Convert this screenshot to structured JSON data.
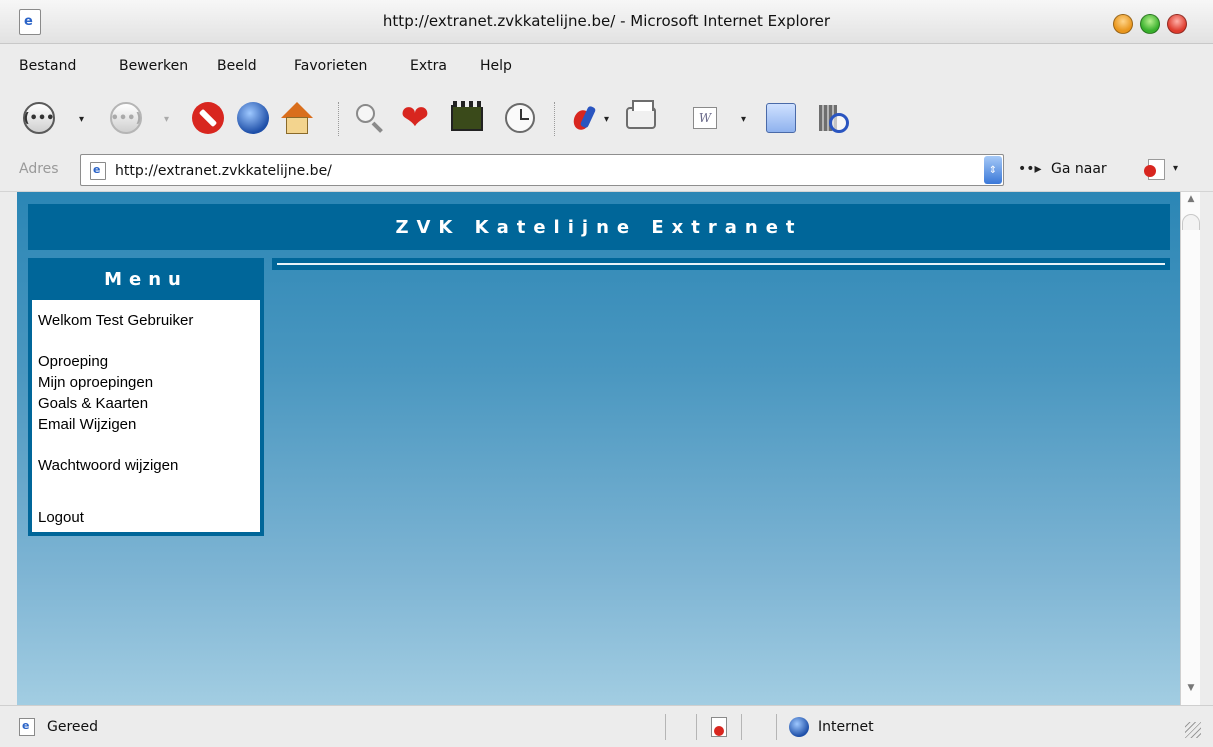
{
  "window": {
    "title": "http://extranet.zvkkatelijne.be/ - Microsoft Internet Explorer"
  },
  "menubar": {
    "items": [
      "Bestand",
      "Bewerken",
      "Beeld",
      "Favorieten",
      "Extra",
      "Help"
    ]
  },
  "toolbar": {
    "back_glyph": "(•••",
    "forward_glyph": "•••)",
    "dropdown_glyph": "▾",
    "word_glyph": "W",
    "icons": [
      "back-icon",
      "forward-icon",
      "stop-icon",
      "refresh-globe-icon",
      "home-icon",
      "search-icon",
      "favorites-heart-icon",
      "media-icon",
      "history-clock-icon",
      "mail-icon",
      "print-icon",
      "edit-word-icon",
      "discuss-note-icon",
      "research-icon"
    ]
  },
  "address": {
    "label": "Adres",
    "url": "http://extranet.zvkkatelijne.be/",
    "go_label": "Ga naar",
    "go_glyph": "••▸",
    "dropdown_glyph": "⇕"
  },
  "page": {
    "header_title": "ZVK Katelijne Extranet",
    "menu_heading": "Menu",
    "welcome": "Welkom Test Gebruiker",
    "links": [
      "Oproeping",
      "Mijn oproepingen",
      "Goals & Kaarten",
      "Email Wijzigen"
    ],
    "password_link": "Wachtwoord wijzigen",
    "logout_link": "Logout"
  },
  "scrollbar": {
    "up_glyph": "▲",
    "down_glyph": "▼"
  },
  "status": {
    "text": "Gereed",
    "zone": "Internet"
  },
  "colors": {
    "header_blue": "#006699",
    "page_gradient_top": "#2b86b5",
    "page_gradient_bottom": "#a2cde2"
  }
}
